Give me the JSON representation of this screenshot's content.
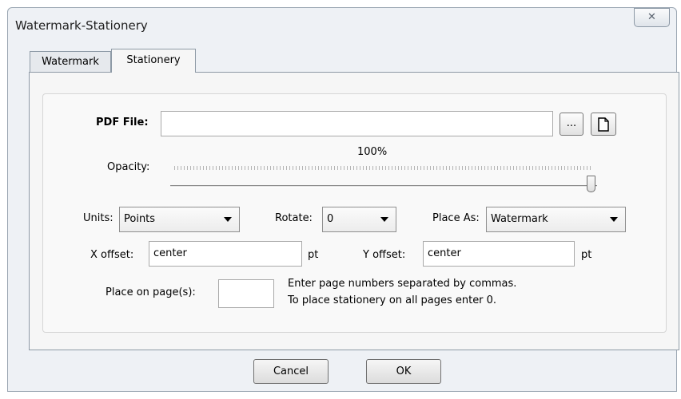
{
  "window": {
    "title": "Watermark-Stationery",
    "close_glyph": "✕"
  },
  "tabs": [
    {
      "label": "Watermark",
      "active": false
    },
    {
      "label": "Stationery",
      "active": true
    }
  ],
  "pdf_file": {
    "label": "PDF File:",
    "value": "",
    "browse_label": "...",
    "new_icon": "document-icon"
  },
  "opacity": {
    "label": "Opacity:",
    "value_text": "100%",
    "value": 1.0
  },
  "units": {
    "label": "Units:",
    "selected": "Points"
  },
  "rotate": {
    "label": "Rotate:",
    "selected": "0"
  },
  "place_as": {
    "label": "Place As:",
    "selected": "Watermark"
  },
  "x_offset": {
    "label": "X offset:",
    "value": "center",
    "unit": "pt"
  },
  "y_offset": {
    "label": "Y offset:",
    "value": "center",
    "unit": "pt"
  },
  "pages": {
    "label": "Place on page(s):",
    "value": "",
    "hint_line1": "Enter page numbers separated by commas.",
    "hint_line2": "To place stationery on all pages enter 0."
  },
  "buttons": {
    "cancel": "Cancel",
    "ok": "OK"
  }
}
